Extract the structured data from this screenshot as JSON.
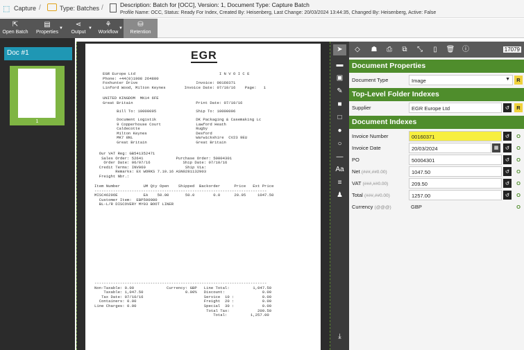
{
  "breadcrumbs": {
    "capture": "Capture",
    "type": "Type: Batches",
    "sep": "/"
  },
  "description": {
    "line1": "Description: Batch for [OCC], Version: 1, Document Type: Capture Batch",
    "line2": "Profile Name: OCC, Status: Ready For Index, Created By: Heisenberg, Last Change: 20/03/2024 13:44:35, Changed By: Heisenberg, Active: False"
  },
  "toolbar": {
    "open_batch": "Open Batch",
    "properties": "Properties",
    "output": "Output",
    "workflow": "Workflow",
    "retention": "Retention"
  },
  "left": {
    "doc_tab": "Doc #1",
    "thumb_num": "1"
  },
  "document": {
    "logo": "EGR",
    "block1": "EGR Europe Ltd                                    I N V O I C E\nPhone: +44(0)1908 264800\nFoxhunter Drive                         Invoice: 00160371\nLinford Wood, Milton Keynes        Invoice Date: 07/10/16    Page:   1",
    "block2": "UNITED KINGDOM  MK14 6FE\nGreat Britain                           Print Date: 07/10/16",
    "block3": "      Bill To: 10000095                 Ship To: 10000096",
    "block4": "      Document Logistik                 DK Packaging & Casemaking Lc\n      9 Copperhouse Court               Lawford Heath\n      Caldecotte                        Rugby\n      Milton Keynes                     Desford\n      MK7 8NL                           Warwickshire  CV23 9EU\n      Great Britain                     Great Britain",
    "block5": "  Our VAT Reg: GB541352471\n   Sales Order: 52641              Purchase Order: 50004301\n    Order Date: 06/07/16              Ship Date: 07/10/16\n  Credit Terms: INV060                 Ship Via:\n         Remarks: EX WORKS 7.10.16 ASN0281132903\n  Freight Nbr.:",
    "block6": "Item Number          UM Qty Open    Shipped  Backorder      Price   Ext Price\n--------------------------------------------------------------------------\nMISC4629OE           EA    50.00       50.0        0.0      20.95     1047.50\n  Customer Item:  EBP500080\n  BL-L/R DISCOVERY MY03 BOOT LINER",
    "block7": "--------------------------------------------------------------------------\nNon-Taxable: 0.00              Currency: GBP   Line Total:          1,047.50\n    Taxable: 1,047.50                  0.00%   Discount:                0.00\n   Tax Date: 07/10/16                          Service  10 :            0.00\n  Containers: 0.00                             Freight  20 :            0.00\nLine Charges: 0.00                             Special  30 :            0.00\n                                                Total Tax:            209.50\n                                                   Total:          1,257.00"
  },
  "right": {
    "counter": "17079",
    "doc_props_title": "Document Properties",
    "doc_type_label": "Document Type",
    "doc_type_value": "Image",
    "folder_title": "Top-Level Folder Indexes",
    "supplier_label": "Supplier",
    "supplier_value": "EGR Europe Ltd",
    "indexes_title": "Document Indexes",
    "fields": [
      {
        "label": "Invoice Number",
        "hint": "",
        "value": "00160371"
      },
      {
        "label": "Invoice Date",
        "hint": "",
        "value": "20/03/2024"
      },
      {
        "label": "PO",
        "hint": "",
        "value": "50004301"
      },
      {
        "label": "Net",
        "hint": "(###,##0.00)",
        "value": "1047.50"
      },
      {
        "label": "VAT",
        "hint": "(###,##0.00)",
        "value": "209.50"
      },
      {
        "label": "Total",
        "hint": "(###,##0.00)",
        "value": "1257.00"
      },
      {
        "label": "Currency",
        "hint": "(@@@)",
        "value": "GBP"
      }
    ],
    "o_letter": "O",
    "r_letter": "R"
  },
  "colors": {
    "accent_green": "#4f8d2c",
    "tab_blue": "#1f97b4",
    "highlight_yellow": "#f7ef3f"
  }
}
